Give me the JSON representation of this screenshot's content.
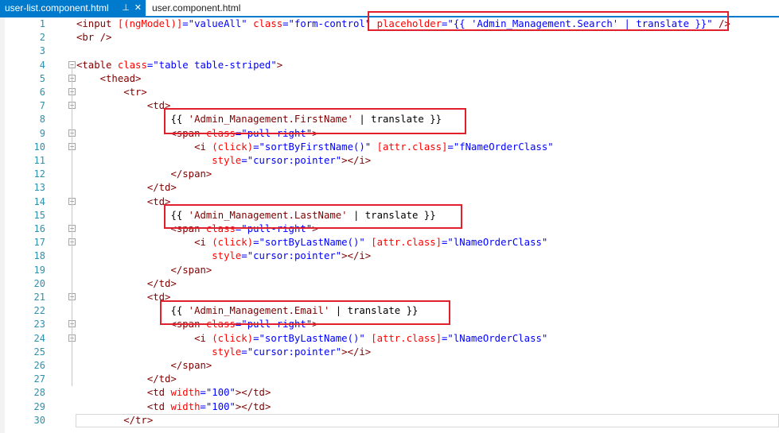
{
  "tabs": [
    {
      "label": "user-list.component.html",
      "active": true,
      "pin_icon": "pin-icon",
      "close_icon": "close-icon"
    },
    {
      "label": "user.component.html",
      "active": false
    }
  ],
  "colors": {
    "tag": "#800000",
    "attribute": "#ff0000",
    "string": "#0000ff",
    "line_number": "#2b91af",
    "highlight_box": "#e0202c",
    "active_tab": "#007acc"
  },
  "lines": [
    {
      "n": "1",
      "tokens": [
        {
          "t": "<input ",
          "c": "tag"
        },
        {
          "t": "[(ngModel)]",
          "c": "attr"
        },
        {
          "t": "=\"valueAll\" ",
          "c": "str"
        },
        {
          "t": "class",
          "c": "attr"
        },
        {
          "t": "=\"form-control\" ",
          "c": "str"
        },
        {
          "t": "placeholder",
          "c": "attr"
        },
        {
          "t": "=\"{{ 'Admin_Management.Search' | translate }}\" ",
          "c": "str"
        },
        {
          "t": "/>",
          "c": "tag"
        }
      ]
    },
    {
      "n": "2",
      "tokens": [
        {
          "t": "<br />",
          "c": "tag"
        }
      ]
    },
    {
      "n": "3",
      "tokens": []
    },
    {
      "n": "4",
      "tokens": [
        {
          "t": "<table ",
          "c": "tag"
        },
        {
          "t": "class",
          "c": "attr"
        },
        {
          "t": "=\"table table-striped\"",
          "c": "str"
        },
        {
          "t": ">",
          "c": "tag"
        }
      ]
    },
    {
      "n": "5",
      "tokens": [
        {
          "t": "    <thead>",
          "c": "tag"
        }
      ]
    },
    {
      "n": "6",
      "tokens": [
        {
          "t": "        <tr>",
          "c": "tag"
        }
      ]
    },
    {
      "n": "7",
      "tokens": [
        {
          "t": "            <td>",
          "c": "tag"
        }
      ]
    },
    {
      "n": "8",
      "tokens": [
        {
          "t": "                {{ ",
          "c": "txt"
        },
        {
          "t": "'Admin_Management.FirstName'",
          "c": "tag"
        },
        {
          "t": " | translate }}",
          "c": "txt"
        }
      ]
    },
    {
      "n": "9",
      "tokens": [
        {
          "t": "                <span ",
          "c": "tag"
        },
        {
          "t": "class",
          "c": "attr"
        },
        {
          "t": "=\"pull-right\"",
          "c": "str"
        },
        {
          "t": ">",
          "c": "tag"
        }
      ]
    },
    {
      "n": "10",
      "tokens": [
        {
          "t": "                    <i ",
          "c": "tag"
        },
        {
          "t": "(click)",
          "c": "attr"
        },
        {
          "t": "=\"sortByFirstName()\" ",
          "c": "str"
        },
        {
          "t": "[attr.class]",
          "c": "attr"
        },
        {
          "t": "=\"fNameOrderClass\"",
          "c": "str"
        }
      ]
    },
    {
      "n": "11",
      "tokens": [
        {
          "t": "                       ",
          "c": "txt"
        },
        {
          "t": "style",
          "c": "attr"
        },
        {
          "t": "=\"cursor:pointer\"",
          "c": "str"
        },
        {
          "t": "></i>",
          "c": "tag"
        }
      ]
    },
    {
      "n": "12",
      "tokens": [
        {
          "t": "                </span>",
          "c": "tag"
        }
      ]
    },
    {
      "n": "13",
      "tokens": [
        {
          "t": "            </td>",
          "c": "tag"
        }
      ]
    },
    {
      "n": "14",
      "tokens": [
        {
          "t": "            <td>",
          "c": "tag"
        }
      ]
    },
    {
      "n": "15",
      "tokens": [
        {
          "t": "                {{ ",
          "c": "txt"
        },
        {
          "t": "'Admin_Management.LastName'",
          "c": "tag"
        },
        {
          "t": " | translate }}",
          "c": "txt"
        }
      ]
    },
    {
      "n": "16",
      "tokens": [
        {
          "t": "                <span ",
          "c": "tag"
        },
        {
          "t": "class",
          "c": "attr"
        },
        {
          "t": "=\"pull-right\"",
          "c": "str"
        },
        {
          "t": ">",
          "c": "tag"
        }
      ]
    },
    {
      "n": "17",
      "tokens": [
        {
          "t": "                    <i ",
          "c": "tag"
        },
        {
          "t": "(click)",
          "c": "attr"
        },
        {
          "t": "=\"sortByLastName()\" ",
          "c": "str"
        },
        {
          "t": "[attr.class]",
          "c": "attr"
        },
        {
          "t": "=\"lNameOrderClass\"",
          "c": "str"
        }
      ]
    },
    {
      "n": "18",
      "tokens": [
        {
          "t": "                       ",
          "c": "txt"
        },
        {
          "t": "style",
          "c": "attr"
        },
        {
          "t": "=\"cursor:pointer\"",
          "c": "str"
        },
        {
          "t": "></i>",
          "c": "tag"
        }
      ]
    },
    {
      "n": "19",
      "tokens": [
        {
          "t": "                </span>",
          "c": "tag"
        }
      ]
    },
    {
      "n": "20",
      "tokens": [
        {
          "t": "            </td>",
          "c": "tag"
        }
      ]
    },
    {
      "n": "21",
      "tokens": [
        {
          "t": "            <td>",
          "c": "tag"
        }
      ]
    },
    {
      "n": "22",
      "tokens": [
        {
          "t": "                {{ ",
          "c": "txt"
        },
        {
          "t": "'Admin_Management.Email'",
          "c": "tag"
        },
        {
          "t": " | translate }}",
          "c": "txt"
        }
      ]
    },
    {
      "n": "23",
      "tokens": [
        {
          "t": "                <span ",
          "c": "tag"
        },
        {
          "t": "class",
          "c": "attr"
        },
        {
          "t": "=\"pull-right\"",
          "c": "str"
        },
        {
          "t": ">",
          "c": "tag"
        }
      ]
    },
    {
      "n": "24",
      "tokens": [
        {
          "t": "                    <i ",
          "c": "tag"
        },
        {
          "t": "(click)",
          "c": "attr"
        },
        {
          "t": "=\"sortByLastName()\" ",
          "c": "str"
        },
        {
          "t": "[attr.class]",
          "c": "attr"
        },
        {
          "t": "=\"lNameOrderClass\"",
          "c": "str"
        }
      ]
    },
    {
      "n": "25",
      "tokens": [
        {
          "t": "                       ",
          "c": "txt"
        },
        {
          "t": "style",
          "c": "attr"
        },
        {
          "t": "=\"cursor:pointer\"",
          "c": "str"
        },
        {
          "t": "></i>",
          "c": "tag"
        }
      ]
    },
    {
      "n": "26",
      "tokens": [
        {
          "t": "                </span>",
          "c": "tag"
        }
      ]
    },
    {
      "n": "27",
      "tokens": [
        {
          "t": "            </td>",
          "c": "tag"
        }
      ]
    },
    {
      "n": "28",
      "tokens": [
        {
          "t": "            <td ",
          "c": "tag"
        },
        {
          "t": "width",
          "c": "attr"
        },
        {
          "t": "=\"100\"",
          "c": "str"
        },
        {
          "t": "></td>",
          "c": "tag"
        }
      ]
    },
    {
      "n": "29",
      "tokens": [
        {
          "t": "            <td ",
          "c": "tag"
        },
        {
          "t": "width",
          "c": "attr"
        },
        {
          "t": "=\"100\"",
          "c": "str"
        },
        {
          "t": "></td>",
          "c": "tag"
        }
      ]
    },
    {
      "n": "30",
      "tokens": [
        {
          "t": "        </tr>",
          "c": "tag"
        }
      ]
    }
  ],
  "folds": [
    "4",
    "5",
    "6",
    "7",
    "9",
    "10",
    "14",
    "16",
    "17",
    "21",
    "23",
    "24"
  ]
}
